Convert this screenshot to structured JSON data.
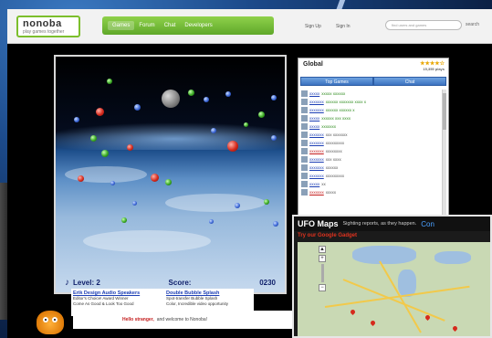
{
  "site": {
    "logo_text": "nonoba",
    "logo_sub": "play games together"
  },
  "nav": {
    "tabs": [
      "Games",
      "Forum",
      "Chat",
      "Developers"
    ],
    "active": "Games"
  },
  "auth": {
    "signup": "Sign Up",
    "signin": "Sign In"
  },
  "search": {
    "placeholder": "find users and games",
    "button": "search"
  },
  "game": {
    "level_label": "Level: 2",
    "score_label": "Score:",
    "score_value": "0230"
  },
  "chat": {
    "title": "Global",
    "rating_stars": "★★★★☆",
    "plays": "15,355 plays",
    "tabs": [
      "Top Games",
      "Chat"
    ],
    "rows": [
      {
        "name": "xxxxx",
        "msg": "xxxxx xxxxxx",
        "name_red": false,
        "gray": false
      },
      {
        "name": "xxxxxxx",
        "msg": "xxxxxx xxxxxxx xxxx x",
        "name_red": false,
        "gray": false
      },
      {
        "name": "xxxxxxx",
        "msg": "xxxxxx xxxxxx x",
        "name_red": false,
        "gray": false
      },
      {
        "name": "xxxxx",
        "msg": "xxxxxx xxx xxxx",
        "name_red": false,
        "gray": false
      },
      {
        "name": "xxxxx",
        "msg": "xxxxxxx",
        "name_red": false,
        "gray": false
      },
      {
        "name": "xxxxxxx",
        "msg": "xxx xxxxxxx",
        "name_red": false,
        "gray": true
      },
      {
        "name": "xxxxxxx",
        "msg": "xxxxxxxxx",
        "name_red": false,
        "gray": true
      },
      {
        "name": "xxxxxxx",
        "msg": "xxxxxxxx",
        "name_red": true,
        "gray": true
      },
      {
        "name": "xxxxxxx",
        "msg": "xxx xxxx",
        "name_red": false,
        "gray": true
      },
      {
        "name": "xxxxxxx",
        "msg": "xxxxxx",
        "name_red": false,
        "gray": true
      },
      {
        "name": "xxxxxxx",
        "msg": "xxxxxxxxx",
        "name_red": false,
        "gray": true
      },
      {
        "name": "xxxxx",
        "msg": "xx",
        "name_red": false,
        "gray": true
      },
      {
        "name": "xxxxxxx",
        "msg": "xxxxx",
        "name_red": true,
        "gray": true
      }
    ]
  },
  "ads": [
    {
      "title": "Erik Design Audio Speakers",
      "lines": [
        "Editor's Choice! Award Winner",
        "Come As Good & Look Too Good"
      ]
    },
    {
      "title": "Double Bubble Splash",
      "lines": [
        "Spot-transfer Bubble Splash",
        "Color, Incredible video opportunity"
      ]
    }
  ],
  "welcome": {
    "greeting": "Hello stranger,",
    "message": "and welcome to Nonoba!"
  },
  "ufo_maps": {
    "title": "UFO Maps",
    "tagline": "Sighting reports, as they happen.",
    "more": "Con",
    "subtitle": "Try our Google Gadget"
  },
  "colors": {
    "nav_green": "#6fb833",
    "link_blue": "#1d3fb5",
    "alert_red": "#e0321e"
  }
}
